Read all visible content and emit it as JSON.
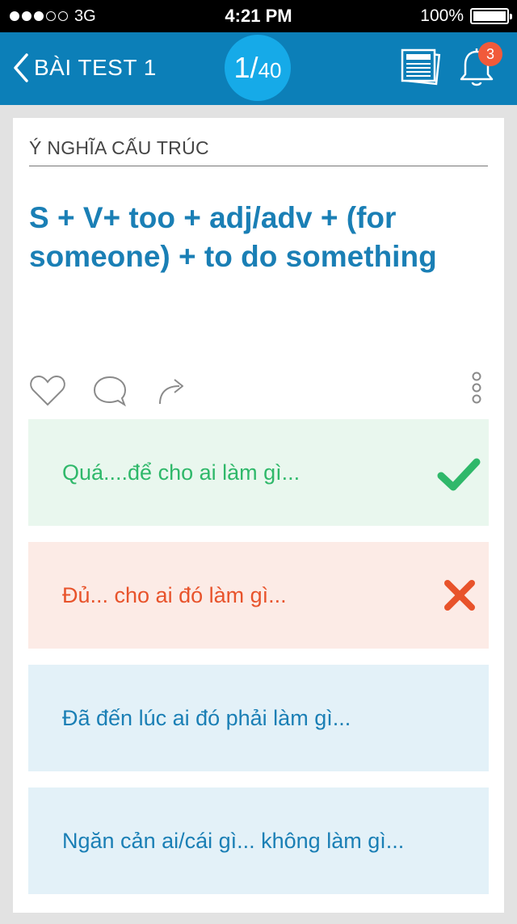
{
  "status_bar": {
    "carrier": "3G",
    "time": "4:21 PM",
    "battery": "100%",
    "signal_dots_filled": 3,
    "signal_dots_total": 5
  },
  "header": {
    "back_label": "BÀI TEST 1",
    "counter_current": "1",
    "counter_separator": "/",
    "counter_total": "40",
    "notification_count": "3",
    "icons": [
      "chevron-left-icon",
      "newspaper-icon",
      "bell-icon"
    ]
  },
  "card": {
    "section_label": "Ý NGHĨA CẤU TRÚC",
    "structure": "S + V+ too + adj/adv + (for someone) + to do something",
    "action_icons": [
      "heart-icon",
      "comment-icon",
      "share-icon",
      "more-vertical-icon"
    ],
    "options": [
      {
        "text": "Quá....để cho ai làm gì...",
        "state": "correct",
        "icon": "checkmark-icon"
      },
      {
        "text": "Đủ... cho ai đó làm gì...",
        "state": "wrong",
        "icon": "cross-icon"
      },
      {
        "text": "Đã đến lúc ai đó phải làm gì...",
        "state": "neutral"
      },
      {
        "text": "Ngăn cản ai/cái gì... không làm gì...",
        "state": "neutral"
      }
    ]
  },
  "colors": {
    "header_bg": "#0c7fb8",
    "counter_bg": "#16aae8",
    "badge": "#f15a3a",
    "correct": "#2fb86a",
    "wrong": "#e8532b",
    "neutral": "#1a7fb5"
  }
}
